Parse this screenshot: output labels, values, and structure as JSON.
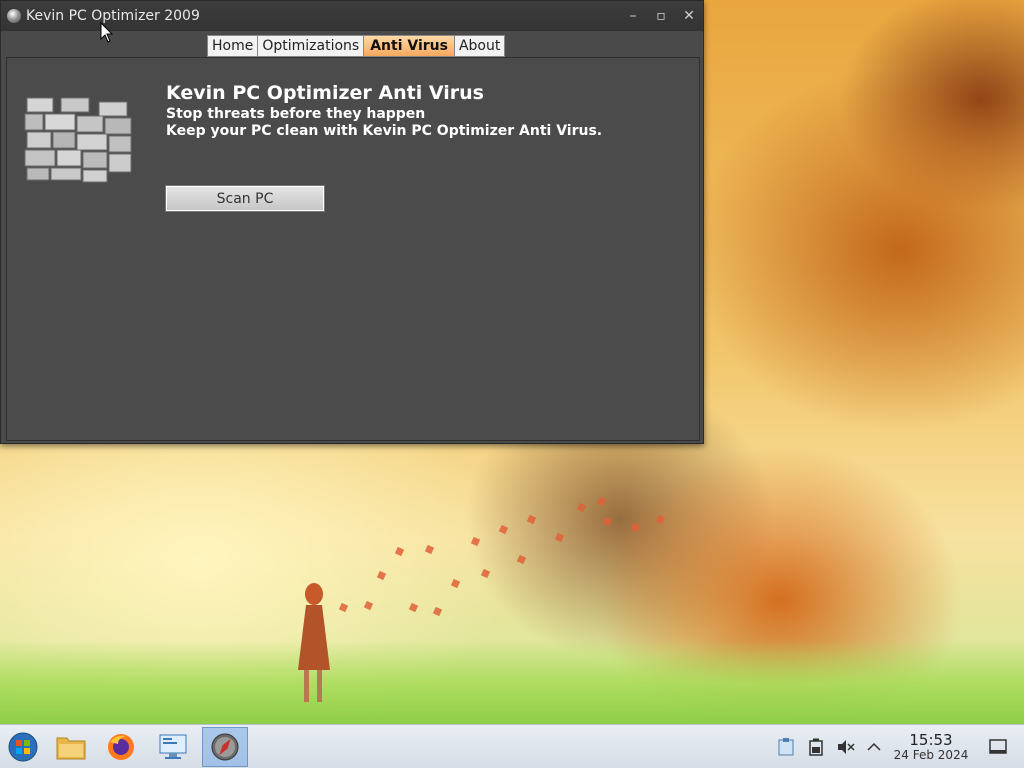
{
  "window": {
    "title": "Kevin PC Optimizer 2009",
    "controls": {
      "minimize": "–",
      "maximize": "▫",
      "close": "✕"
    }
  },
  "tabs": [
    {
      "label": "Home",
      "active": false
    },
    {
      "label": "Optimizations",
      "active": false
    },
    {
      "label": "Anti Virus",
      "active": true
    },
    {
      "label": "About",
      "active": false
    }
  ],
  "content": {
    "heading": "Kevin PC Optimizer Anti Virus",
    "line1": "Stop threats before they happen",
    "line2": "Keep your PC clean with Kevin PC Optimizer Anti Virus.",
    "scan_button": "Scan PC",
    "icon": "firewall-brick-wall-icon"
  },
  "taskbar": {
    "start_icon": "start-orb-icon",
    "apps": [
      "file-manager-icon",
      "firefox-icon",
      "remote-desktop-icon",
      "compass-app-icon"
    ],
    "tray": [
      "clipboard-icon",
      "battery-icon",
      "volume-muted-icon",
      "chevron-up-icon"
    ],
    "clock": {
      "time": "15:53",
      "date": "24 Feb 2024"
    },
    "show_desktop_icon": "show-desktop-icon"
  },
  "colors": {
    "window_bg": "#4a4a4a",
    "active_tab": "#f6a85c",
    "taskbar": "#dfe5ec"
  }
}
